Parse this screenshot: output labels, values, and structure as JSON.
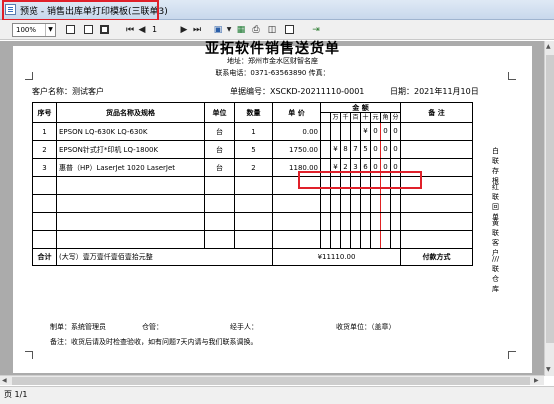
{
  "window": {
    "title": "预览 - 销售出库单打印模板(三联单3)",
    "status": "页 1/1"
  },
  "toolbar": {
    "zoom": "100%",
    "page_current": "1"
  },
  "doc": {
    "company": "亚拓软件销售送货单",
    "address": "地址：郑州市金水区财智名座",
    "tel": "联系电话：0371-63563890   传真：",
    "customer": "客户名称：测试客户",
    "doc_no": "单据编号：XSCKD-20211110-0001",
    "date": "日期：2021年11月10日"
  },
  "table": {
    "headers": {
      "seq": "序号",
      "name": "货品名称及规格",
      "unit": "单位",
      "qty": "数量",
      "price": "单 价",
      "amount": "金 额",
      "remark": "备  注"
    },
    "amount_units": [
      "万",
      "千",
      "百",
      "十",
      "元",
      "角",
      "分"
    ],
    "rows": [
      {
        "seq": "1",
        "name": "EPSON LQ-630K LQ-630K",
        "unit": "台",
        "qty": "1",
        "price": "0.00",
        "digits": [
          "",
          "",
          "",
          "",
          "¥",
          "0",
          "0",
          "0"
        ]
      },
      {
        "seq": "2",
        "name": "EPSON针式打*印机 LQ-1800K",
        "unit": "台",
        "qty": "5",
        "price": "1750.00",
        "digits": [
          "",
          "¥",
          "8",
          "7",
          "5",
          "0",
          "0",
          "0"
        ]
      },
      {
        "seq": "3",
        "name": "惠普（HP）LaserJet 1020 LaserJet",
        "unit": "台",
        "qty": "2",
        "price": "1180.00",
        "digits": [
          "",
          "¥",
          "2",
          "3",
          "6",
          "0",
          "0",
          "0"
        ]
      }
    ],
    "total_label": "合计",
    "total_words": "(大写）壹万壹仟壹佰壹拾元整",
    "total_value": "¥11110.00",
    "payment_label": "付款方式"
  },
  "side_notes": [
    "白联存根",
    "红联回单",
    "黄联客户",
    "///联仓库"
  ],
  "footer": {
    "maker": "制单：系统管理员",
    "keeper": "仓管：",
    "handler": "经手人：",
    "receiver": "收货单位：（盖章）",
    "note": "备注：收货后请及时检查验收，如有问题7天内请与我们联系调换。"
  }
}
